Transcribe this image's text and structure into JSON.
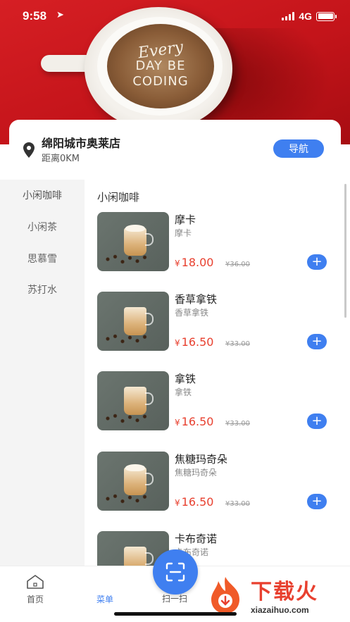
{
  "status": {
    "time": "9:58",
    "network": "4G"
  },
  "banner": {
    "line1": "Every",
    "line2": "DAY BE",
    "line3": "CODING"
  },
  "store": {
    "name": "绵阳城市奥莱店",
    "distance": "距离0KM",
    "nav_label": "导航"
  },
  "categories": [
    {
      "label": "小闲咖啡",
      "active": true
    },
    {
      "label": "小闲茶",
      "active": false
    },
    {
      "label": "思慕雪",
      "active": false
    },
    {
      "label": "苏打水",
      "active": false
    }
  ],
  "section_title": "小闲咖啡",
  "currency": "¥",
  "products": [
    {
      "name": "摩卡",
      "subtitle": "摩卡",
      "price": "18.00",
      "original_price": "¥36.00",
      "add_icon": "plus-icon"
    },
    {
      "name": "香草拿铁",
      "subtitle": "香草拿铁",
      "price": "16.50",
      "original_price": "¥33.00",
      "add_icon": "plus-icon"
    },
    {
      "name": "拿铁",
      "subtitle": "拿铁",
      "price": "16.50",
      "original_price": "¥33.00",
      "add_icon": "plus-icon"
    },
    {
      "name": "焦糖玛奇朵",
      "subtitle": "焦糖玛奇朵",
      "price": "16.50",
      "original_price": "¥33.00",
      "add_icon": "plus-icon"
    },
    {
      "name": "卡布奇诺",
      "subtitle": "卡布奇诺",
      "price": "",
      "original_price": "",
      "add_icon": "plus-icon"
    }
  ],
  "tabs": {
    "home": "首页",
    "menu": "菜单",
    "scan": "扫一扫"
  },
  "watermark": {
    "text": "下载火",
    "url": "xiazaihuo.com"
  },
  "colors": {
    "brand_blue": "#3f7ff0",
    "price_red": "#e8402f",
    "banner_red": "#d61f24"
  }
}
